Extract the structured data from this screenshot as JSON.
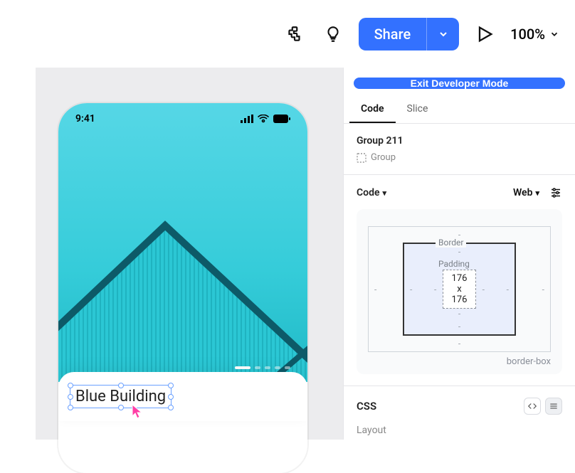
{
  "topbar": {
    "share_label": "Share",
    "zoom_label": "100%"
  },
  "canvas": {
    "status_time": "9:41",
    "card_title": "Blue Building"
  },
  "panel": {
    "exit_label": "Exit Developer Mode",
    "tabs": {
      "code": "Code",
      "slice": "Slice"
    },
    "layer_name": "Group 211",
    "layer_type": "Group",
    "code_dropdown": "Code",
    "platform_dropdown": "Web",
    "box_model": {
      "border_label": "Border",
      "padding_label": "Padding",
      "content_size": "176 x 176",
      "sizing_label": "border-box"
    },
    "css_title": "CSS",
    "layout_label": "Layout"
  }
}
